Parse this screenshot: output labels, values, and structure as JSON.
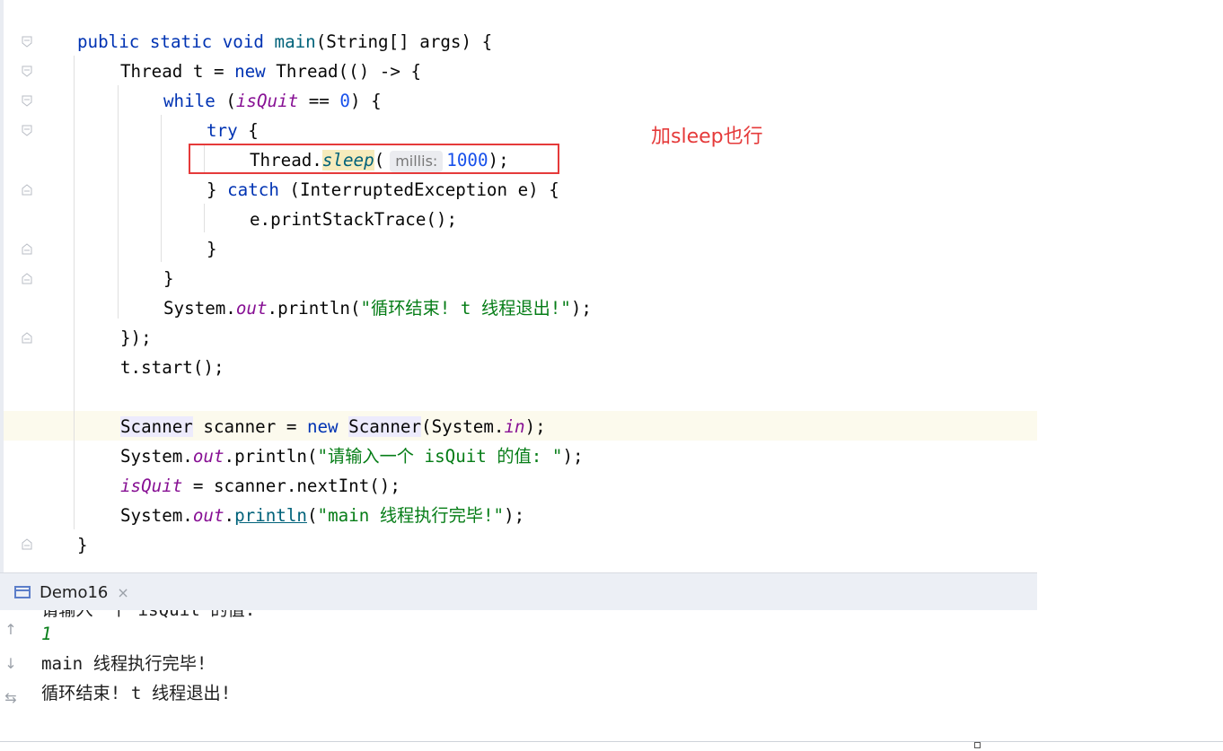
{
  "editor": {
    "tokens": {
      "public": "public",
      "static": "static",
      "void": "void",
      "main": "main",
      "string_args": "(String[] args) {",
      "thread_decl": "Thread t = ",
      "new": "new",
      "thread_ctor": " Thread(() -> {",
      "while": "while",
      "paren_open": " (",
      "isQuit": "isQuit",
      "eq": " == ",
      "zero": "0",
      "paren_close_brace": ") {",
      "try": "try",
      "brace_open": " {",
      "thread_dot": "Thread.",
      "sleep": "sleep",
      "open_paren": "(",
      "hint_millis": "millis:",
      "val_1000": "1000",
      "close_semicolon": ");",
      "close_brace_sp": "} ",
      "catch": "catch",
      "catch_args": " (InterruptedException e) {",
      "print_stack": "e.printStackTrace();",
      "close_brace": "}",
      "system_dot": "System.",
      "out": "out",
      "println_open": ".println(",
      "str_loop_end": "\"循环结束! t 线程退出!\"",
      "lambda_close": "});",
      "t_start": "t.start();",
      "scanner_cls": "Scanner",
      "scanner_var": " scanner = ",
      "scanner_cls2": "Scanner",
      "system_in_open": "(System.",
      "in": "in",
      "str_prompt": "\"请输入一个 isQuit 的值: \"",
      "assign": " = scanner.nextInt();",
      "dot": ".",
      "println": "println",
      "str_main_done": "\"main 线程执行完毕!\""
    }
  },
  "annotation": {
    "text": "加sleep也行",
    "color": "#e53a3a"
  },
  "tool_window": {
    "tab_label": "Demo16",
    "close_glyph": "×"
  },
  "console": {
    "partial_line": "请输入一个 isQuit 的值:",
    "lines": [
      "1",
      "main 线程执行完毕!",
      "循环结束! t 线程退出!"
    ]
  },
  "colors": {
    "keyword": "#0033b3",
    "field": "#871094",
    "string": "#067d17",
    "number": "#1750eb",
    "annotation_red": "#e53a3a"
  }
}
